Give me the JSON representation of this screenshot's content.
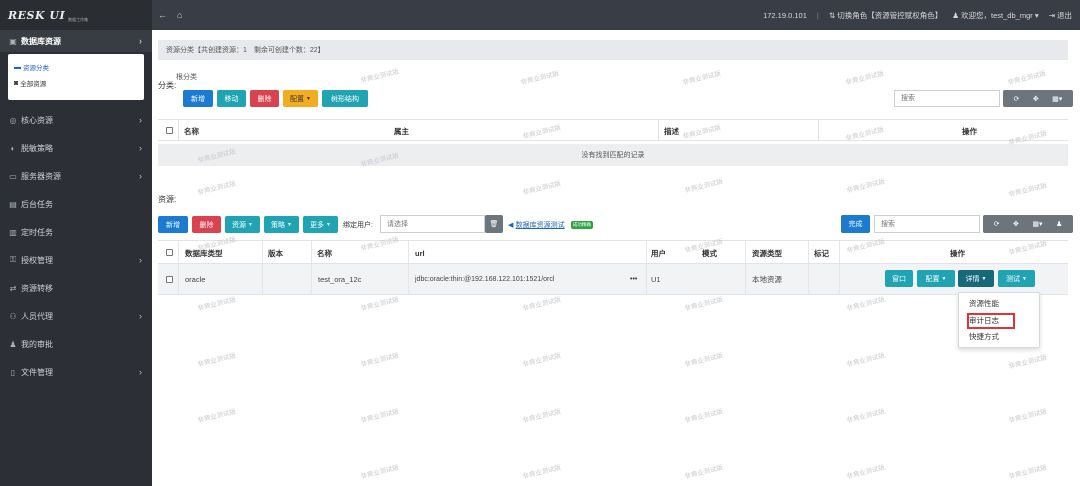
{
  "sidebar": {
    "logo": "RESK UI",
    "logo_sub": "数据工作集",
    "items": [
      {
        "label": "数据库资源",
        "icon": "database-icon"
      },
      {
        "label": "核心资源",
        "icon": "cube-icon"
      },
      {
        "label": "脱敏策略",
        "icon": "mask-icon"
      },
      {
        "label": "服务器资源",
        "icon": "monitor-icon"
      },
      {
        "label": "后台任务",
        "icon": "task-icon"
      },
      {
        "label": "定时任务",
        "icon": "clock-icon"
      },
      {
        "label": "授权管理",
        "icon": "key-icon"
      },
      {
        "label": "资源转移",
        "icon": "transfer-icon"
      },
      {
        "label": "人员代理",
        "icon": "proxy-icon"
      },
      {
        "label": "我的审批",
        "icon": "approval-icon"
      },
      {
        "label": "文件管理",
        "icon": "file-icon"
      }
    ],
    "sub_items": [
      {
        "label": "资源分类"
      },
      {
        "label": "全部资源"
      }
    ]
  },
  "topbar": {
    "ip": "172.19.0.101",
    "switch_role": "切换角色【资源管控赋权角色】",
    "welcome": "欢迎您，test_db_mgr",
    "logout": "退出"
  },
  "info": "资源分类【共创建资源：1　剩余可创建个数：22】",
  "category": {
    "label": "分类:",
    "title": "根分类",
    "buttons": {
      "add": "新增",
      "move": "移动",
      "delete": "删除",
      "config": "配置",
      "tree": "树形结构"
    },
    "search_placeholder": "搜索",
    "columns": [
      "名称",
      "属主",
      "描述",
      "操作"
    ],
    "empty": "没有找到匹配的记录"
  },
  "resources": {
    "label": "资源:",
    "buttons": {
      "add": "新增",
      "delete": "删除",
      "resource": "资源",
      "policy": "策略",
      "more": "更多",
      "complete": "完成"
    },
    "bind_user_label": "绑定用户:",
    "bind_user_placeholder": "请选择",
    "test_link": "数据库资源测试",
    "badge": "成功精确",
    "search_placeholder": "搜索",
    "columns": [
      "数据库类型",
      "版本",
      "名称",
      "url",
      "用户",
      "模式",
      "资源类型",
      "标记",
      "操作"
    ],
    "rows": [
      {
        "db_type": "oracle",
        "version": "",
        "name": "test_ora_12c",
        "url": "jdbc:oracle:thin:@192.168.122.101:1521/orcl",
        "more": "•••",
        "user": "U1",
        "schema": "",
        "resource_type": "本地资源",
        "mark": ""
      }
    ],
    "row_buttons": {
      "window": "窗口",
      "config": "配置",
      "detail": "详情",
      "test": "测试"
    },
    "dropdown": [
      "资源性能",
      "审计日志",
      "快捷方式"
    ]
  },
  "watermark_text": "非商业测试版"
}
